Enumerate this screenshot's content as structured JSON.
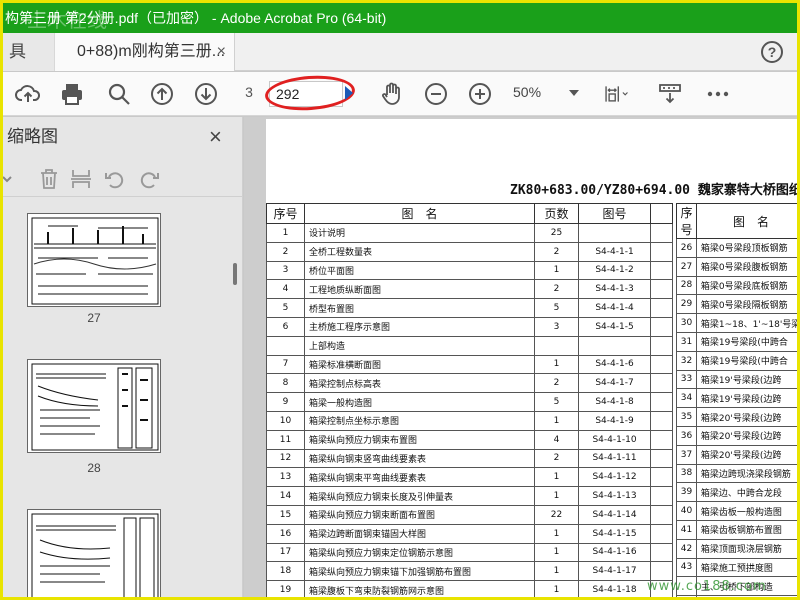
{
  "window": {
    "title": "构第三册 第2分册.pdf（已加密） - Adobe Acrobat Pro (64-bit)",
    "watermark": "土木在线"
  },
  "tabs": {
    "tools_label": "具",
    "document_label": "0+88)m刚构第三册...",
    "close_label": "×",
    "help_label": "?"
  },
  "toolbar": {
    "current_page": "3",
    "page_input": "292",
    "zoom": "50%",
    "icons": [
      "upload-icon",
      "print-icon",
      "search-icon",
      "prev-page-icon",
      "next-page-icon",
      "hand-icon",
      "zoom-out-icon",
      "zoom-in-icon",
      "fit-page-icon",
      "scroll-mode-icon",
      "more-icon"
    ]
  },
  "sidebar": {
    "title": "缩略图",
    "close_label": "×",
    "thumbnails": [
      {
        "label": "27"
      },
      {
        "label": "28"
      },
      {
        "label": ""
      }
    ]
  },
  "document": {
    "title": "ZK80+683.00/YZ80+694.00 魏家寨特大桥图纸目",
    "table_left": {
      "headers": [
        "序号",
        "图　名",
        "页数",
        "图号"
      ],
      "rows": [
        [
          "1",
          "设计说明",
          "25",
          ""
        ],
        [
          "2",
          "全桥工程数量表",
          "2",
          "S4-4-1-1"
        ],
        [
          "3",
          "桥位平面图",
          "1",
          "S4-4-1-2"
        ],
        [
          "4",
          "工程地质纵断面图",
          "2",
          "S4-4-1-3"
        ],
        [
          "5",
          "桥型布置图",
          "5",
          "S4-4-1-4"
        ],
        [
          "6",
          "主桥施工程序示意图",
          "3",
          "S4-4-1-5"
        ],
        [
          "",
          "上部构造",
          "",
          ""
        ],
        [
          "7",
          "箱梁标准横断面图",
          "1",
          "S4-4-1-6"
        ],
        [
          "8",
          "箱梁控制点标高表",
          "2",
          "S4-4-1-7"
        ],
        [
          "9",
          "箱梁一般构造图",
          "5",
          "S4-4-1-8"
        ],
        [
          "10",
          "箱梁控制点坐标示意图",
          "1",
          "S4-4-1-9"
        ],
        [
          "11",
          "箱梁纵向预应力钢束布置图",
          "4",
          "S4-4-1-10"
        ],
        [
          "12",
          "箱梁纵向钢束竖弯曲线要素表",
          "2",
          "S4-4-1-11"
        ],
        [
          "13",
          "箱梁纵向钢束平弯曲线要素表",
          "1",
          "S4-4-1-12"
        ],
        [
          "14",
          "箱梁纵向预应力钢束长度及引伸量表",
          "1",
          "S4-4-1-13"
        ],
        [
          "15",
          "箱梁纵向预应力钢束断面布置图",
          "22",
          "S4-4-1-14"
        ],
        [
          "16",
          "箱梁边跨断面钢束锚固大样图",
          "1",
          "S4-4-1-15"
        ],
        [
          "17",
          "箱梁纵向预应力钢束定位钢筋示意图",
          "1",
          "S4-4-1-16"
        ],
        [
          "18",
          "箱梁纵向预应力钢束锚下加强钢筋布置图",
          "1",
          "S4-4-1-17"
        ],
        [
          "19",
          "箱梁腹板下弯束防裂钢筋网示意图",
          "1",
          "S4-4-1-18"
        ]
      ]
    },
    "table_right": {
      "headers": [
        "序号",
        "图　名"
      ],
      "rows": [
        [
          "26",
          "箱梁0号梁段顶板钢筋"
        ],
        [
          "27",
          "箱梁0号梁段腹板钢筋"
        ],
        [
          "28",
          "箱梁0号梁段底板钢筋"
        ],
        [
          "29",
          "箱梁0号梁段隔板钢筋"
        ],
        [
          "30",
          "箱梁1~18、1'~18'号梁"
        ],
        [
          "31",
          "箱梁19号梁段(中跨合"
        ],
        [
          "32",
          "箱梁19号梁段(中跨合"
        ],
        [
          "33",
          "箱梁19'号梁段(边跨"
        ],
        [
          "34",
          "箱梁19'号梁段(边跨"
        ],
        [
          "35",
          "箱梁20'号梁段(边跨"
        ],
        [
          "36",
          "箱梁20'号梁段(边跨"
        ],
        [
          "37",
          "箱梁20'号梁段(边跨"
        ],
        [
          "38",
          "箱梁边跨现浇梁段钢筋"
        ],
        [
          "39",
          "箱梁边、中跨合龙段"
        ],
        [
          "40",
          "箱梁齿板一般构造图"
        ],
        [
          "41",
          "箱梁齿板钢筋布置图"
        ],
        [
          "42",
          "箱梁顶面现浇层钢筋"
        ],
        [
          "43",
          "箱梁施工预拱度图"
        ],
        [
          "",
          "主、引桥下部构造"
        ],
        [
          "44",
          "桥台基础处理表"
        ]
      ]
    }
  }
}
